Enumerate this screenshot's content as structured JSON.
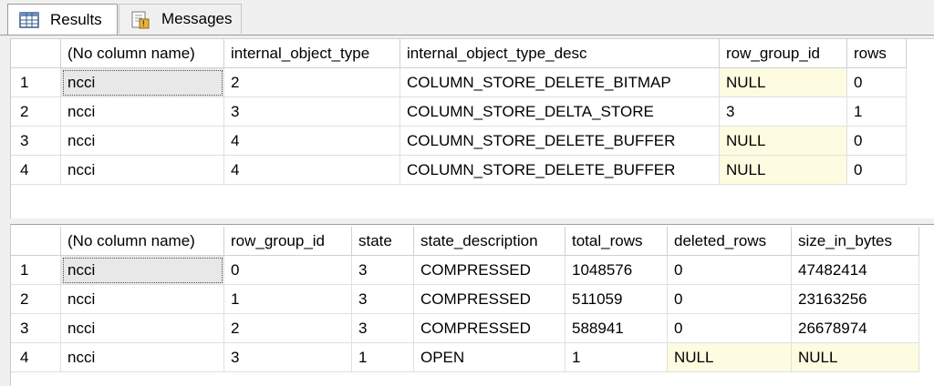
{
  "tabs": [
    {
      "label": "Results",
      "icon": "grid-icon"
    },
    {
      "label": "Messages",
      "icon": "messages-icon"
    }
  ],
  "grid1": {
    "columns": [
      "",
      "(No column name)",
      "internal_object_type",
      "internal_object_type_desc",
      "row_group_id",
      "rows"
    ],
    "rows": [
      [
        "1",
        "ncci",
        "2",
        "COLUMN_STORE_DELETE_BITMAP",
        "NULL",
        "0"
      ],
      [
        "2",
        "ncci",
        "3",
        "COLUMN_STORE_DELTA_STORE",
        "3",
        "1"
      ],
      [
        "3",
        "ncci",
        "4",
        "COLUMN_STORE_DELETE_BUFFER",
        "NULL",
        "0"
      ],
      [
        "4",
        "ncci",
        "4",
        "COLUMN_STORE_DELETE_BUFFER",
        "NULL",
        "0"
      ]
    ]
  },
  "grid2": {
    "columns": [
      "",
      "(No column name)",
      "row_group_id",
      "state",
      "state_description",
      "total_rows",
      "deleted_rows",
      "size_in_bytes"
    ],
    "rows": [
      [
        "1",
        "ncci",
        "0",
        "3",
        "COMPRESSED",
        "1048576",
        "0",
        "47482414"
      ],
      [
        "2",
        "ncci",
        "1",
        "3",
        "COMPRESSED",
        "511059",
        "0",
        "23163256"
      ],
      [
        "3",
        "ncci",
        "2",
        "3",
        "COMPRESSED",
        "588941",
        "0",
        "26678974"
      ],
      [
        "4",
        "ncci",
        "3",
        "1",
        "OPEN",
        "1",
        "NULL",
        "NULL"
      ]
    ]
  },
  "colors": {
    "null_bg": "#fdfbe0",
    "selected_bg": "#e8e8e8"
  }
}
